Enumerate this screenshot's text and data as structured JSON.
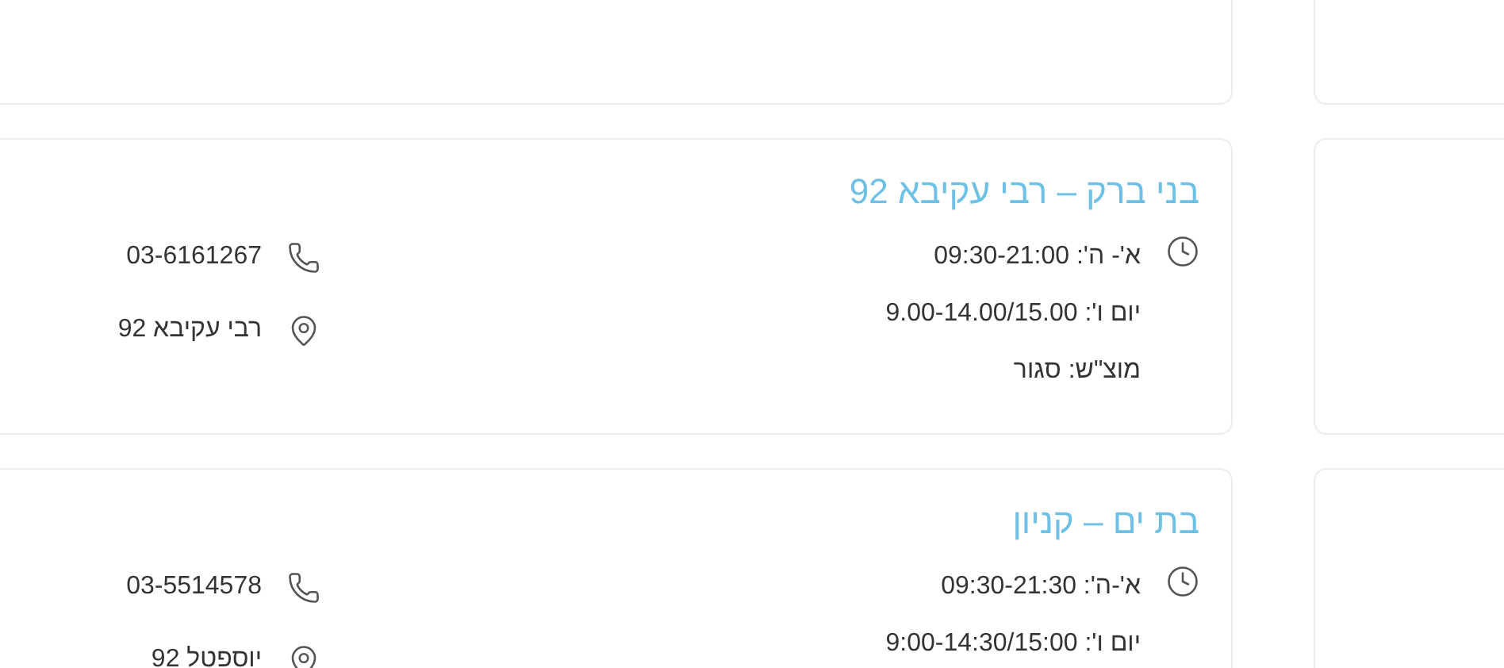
{
  "branches": [
    {
      "title": "בני ברק – רבי עקיבא 92",
      "hours": [
        "א'- ה': 09:30-21:00",
        "יום ו': 9.00-14.00/15.00",
        "מוצ\"ש: סגור"
      ],
      "phone": "03-6161267",
      "address": "רבי עקיבא 92"
    },
    {
      "title": "בת ים – קניון",
      "hours": [
        "א'-ה': 09:30-21:30",
        "יום ו': 9:00-14:30/15:00"
      ],
      "phone": "03-5514578",
      "address": "יוספטל 92"
    }
  ]
}
